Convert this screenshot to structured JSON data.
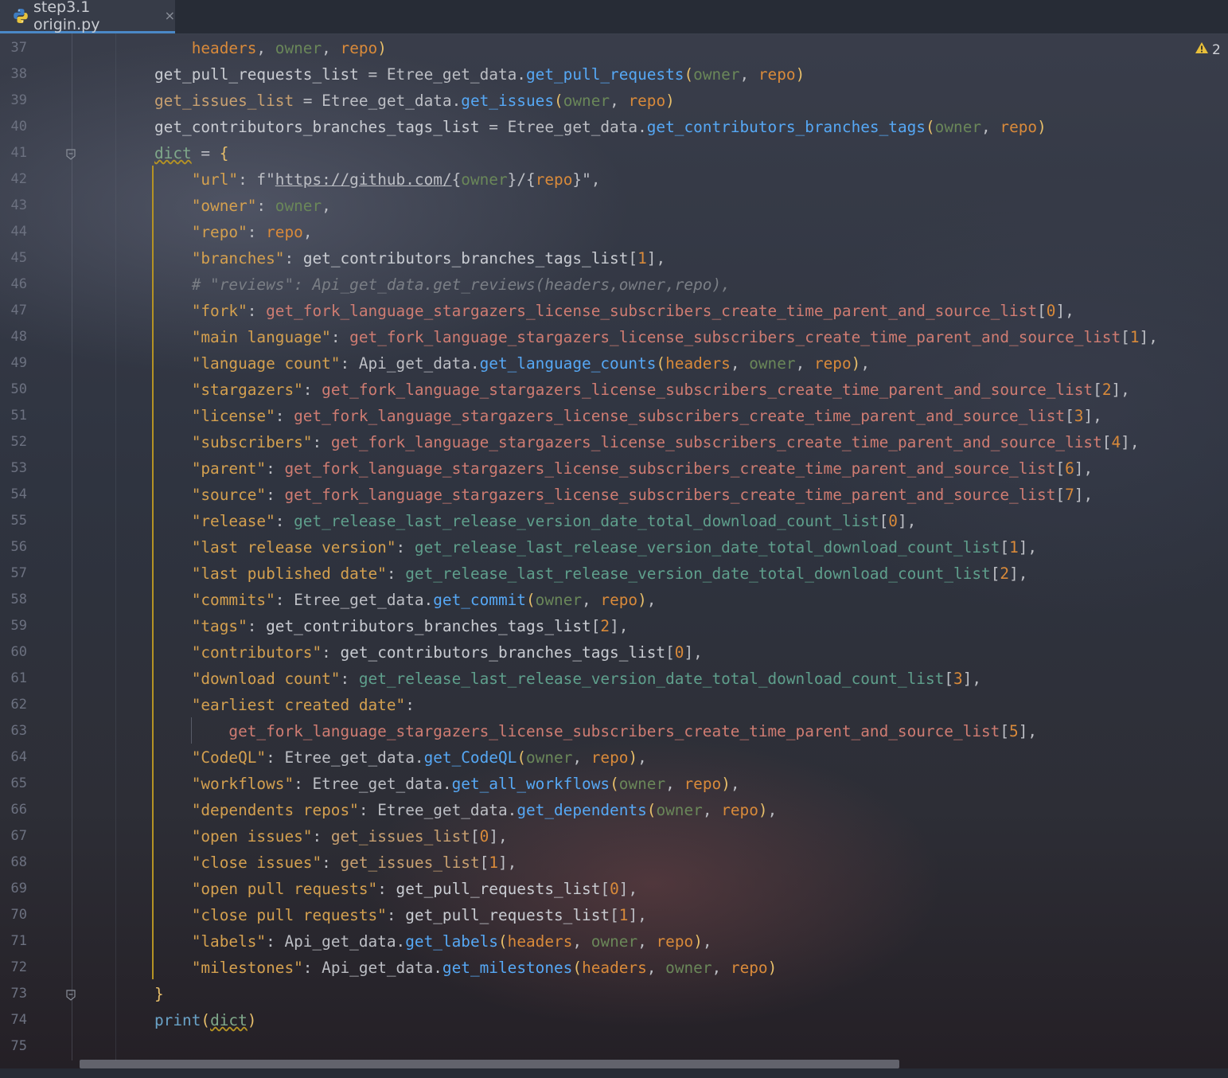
{
  "tab": {
    "title": "step3.1 origin.py",
    "close": "×",
    "icon": "python-file-icon"
  },
  "warnings": {
    "count": "2",
    "icon": "warning-triangle-icon",
    "color": "#e8bf3a"
  },
  "colors": {
    "accent": "#4a88c7",
    "string": "#d4a04f",
    "function": "#56a8f5",
    "param_orange": "#d98a3a",
    "param_green": "#6a8759",
    "bracket": "#e8bf6a",
    "comment": "#7a7e85",
    "guide": "#b59324"
  },
  "lines": [
    {
      "n": "37",
      "t": [
        [
          "    headers",
          "p1"
        ],
        [
          ", ",
          "id"
        ],
        [
          "owner",
          "p2"
        ],
        [
          ", ",
          "id"
        ],
        [
          "repo",
          "p1"
        ],
        [
          ")",
          "brk"
        ]
      ]
    },
    {
      "n": "38",
      "t": [
        [
          "get_pull_requests_list",
          "v"
        ],
        [
          " = Etree_get_data.",
          "id"
        ],
        [
          "get_pull_requests",
          "fn"
        ],
        [
          "(",
          "brk"
        ],
        [
          "owner",
          "p2"
        ],
        [
          ", ",
          "id"
        ],
        [
          "repo",
          "p1"
        ],
        [
          ")",
          "brk"
        ]
      ]
    },
    {
      "n": "39",
      "t": [
        [
          "get_issues_list",
          "v2"
        ],
        [
          " = Etree_get_data.",
          "id"
        ],
        [
          "get_issues",
          "fn"
        ],
        [
          "(",
          "brk"
        ],
        [
          "owner",
          "p2"
        ],
        [
          ", ",
          "id"
        ],
        [
          "repo",
          "p1"
        ],
        [
          ")",
          "brk"
        ]
      ]
    },
    {
      "n": "40",
      "t": [
        [
          "get_contributors_branches_tags_list",
          "v"
        ],
        [
          " = Etree_get_data.",
          "id"
        ],
        [
          "get_contributors_branches_tags",
          "fn"
        ],
        [
          "(",
          "brk"
        ],
        [
          "owner",
          "p2"
        ],
        [
          ", ",
          "id"
        ],
        [
          "repo",
          "p1"
        ],
        [
          ")",
          "brk"
        ]
      ]
    },
    {
      "n": "41",
      "t": [
        [
          "dict",
          "bi"
        ],
        [
          " = ",
          "id"
        ],
        [
          "{",
          "brk"
        ]
      ]
    },
    {
      "n": "42",
      "t": [
        [
          "    \"url\"",
          "s"
        ],
        [
          ": f\"",
          "id"
        ],
        [
          "https://github.com/",
          "url"
        ],
        [
          "{",
          "id"
        ],
        [
          "owner",
          "p2"
        ],
        [
          "}/{",
          "id"
        ],
        [
          "repo",
          "p1"
        ],
        [
          "}\"",
          "id"
        ],
        [
          ",",
          "id"
        ]
      ]
    },
    {
      "n": "43",
      "t": [
        [
          "    \"owner\"",
          "s"
        ],
        [
          ": ",
          "id"
        ],
        [
          "owner",
          "p2"
        ],
        [
          ",",
          "id"
        ]
      ]
    },
    {
      "n": "44",
      "t": [
        [
          "    \"repo\"",
          "s"
        ],
        [
          ": ",
          "id"
        ],
        [
          "repo",
          "p1"
        ],
        [
          ",",
          "id"
        ]
      ]
    },
    {
      "n": "45",
      "t": [
        [
          "    \"branches\"",
          "s"
        ],
        [
          ": ",
          "id"
        ],
        [
          "get_contributors_branches_tags_list",
          "v"
        ],
        [
          "[",
          "id"
        ],
        [
          "1",
          "num"
        ],
        [
          "],",
          "id"
        ]
      ]
    },
    {
      "n": "46",
      "t": [
        [
          "    # \"reviews\": Api_get_data.get_reviews(headers,owner,repo),",
          "cm"
        ]
      ]
    },
    {
      "n": "47",
      "t": [
        [
          "    \"fork\"",
          "s"
        ],
        [
          ": ",
          "id"
        ],
        [
          "get_fork_language_stargazers_license_subscribers_create_time_parent_and_source_list",
          "v3"
        ],
        [
          "[",
          "id"
        ],
        [
          "0",
          "num"
        ],
        [
          "],",
          "id"
        ]
      ]
    },
    {
      "n": "48",
      "t": [
        [
          "    \"main language\"",
          "s"
        ],
        [
          ": ",
          "id"
        ],
        [
          "get_fork_language_stargazers_license_subscribers_create_time_parent_and_source_list",
          "v3"
        ],
        [
          "[",
          "id"
        ],
        [
          "1",
          "num"
        ],
        [
          "],",
          "id"
        ]
      ]
    },
    {
      "n": "49",
      "t": [
        [
          "    \"language count\"",
          "s"
        ],
        [
          ": Api_get_data.",
          "id"
        ],
        [
          "get_language_counts",
          "fn"
        ],
        [
          "(",
          "brk"
        ],
        [
          "headers",
          "p1"
        ],
        [
          ", ",
          "id"
        ],
        [
          "owner",
          "p2"
        ],
        [
          ", ",
          "id"
        ],
        [
          "repo",
          "p1"
        ],
        [
          ")",
          "brk"
        ],
        [
          ",",
          "id"
        ]
      ]
    },
    {
      "n": "50",
      "t": [
        [
          "    \"stargazers\"",
          "s"
        ],
        [
          ": ",
          "id"
        ],
        [
          "get_fork_language_stargazers_license_subscribers_create_time_parent_and_source_list",
          "v3"
        ],
        [
          "[",
          "id"
        ],
        [
          "2",
          "num"
        ],
        [
          "],",
          "id"
        ]
      ]
    },
    {
      "n": "51",
      "t": [
        [
          "    \"license\"",
          "s"
        ],
        [
          ": ",
          "id"
        ],
        [
          "get_fork_language_stargazers_license_subscribers_create_time_parent_and_source_list",
          "v3"
        ],
        [
          "[",
          "id"
        ],
        [
          "3",
          "num"
        ],
        [
          "],",
          "id"
        ]
      ]
    },
    {
      "n": "52",
      "t": [
        [
          "    \"subscribers\"",
          "s"
        ],
        [
          ": ",
          "id"
        ],
        [
          "get_fork_language_stargazers_license_subscribers_create_time_parent_and_source_list",
          "v3"
        ],
        [
          "[",
          "id"
        ],
        [
          "4",
          "num"
        ],
        [
          "],",
          "id"
        ]
      ]
    },
    {
      "n": "53",
      "t": [
        [
          "    \"parent\"",
          "s"
        ],
        [
          ": ",
          "id"
        ],
        [
          "get_fork_language_stargazers_license_subscribers_create_time_parent_and_source_list",
          "v3"
        ],
        [
          "[",
          "id"
        ],
        [
          "6",
          "num"
        ],
        [
          "],",
          "id"
        ]
      ]
    },
    {
      "n": "54",
      "t": [
        [
          "    \"source\"",
          "s"
        ],
        [
          ": ",
          "id"
        ],
        [
          "get_fork_language_stargazers_license_subscribers_create_time_parent_and_source_list",
          "v3"
        ],
        [
          "[",
          "id"
        ],
        [
          "7",
          "num"
        ],
        [
          "],",
          "id"
        ]
      ]
    },
    {
      "n": "55",
      "t": [
        [
          "    \"release\"",
          "s"
        ],
        [
          ": ",
          "id"
        ],
        [
          "get_release_last_release_version_date_total_download_count_list",
          "v4"
        ],
        [
          "[",
          "id"
        ],
        [
          "0",
          "num"
        ],
        [
          "],",
          "id"
        ]
      ]
    },
    {
      "n": "56",
      "t": [
        [
          "    \"last release version\"",
          "s"
        ],
        [
          ": ",
          "id"
        ],
        [
          "get_release_last_release_version_date_total_download_count_list",
          "v4"
        ],
        [
          "[",
          "id"
        ],
        [
          "1",
          "num"
        ],
        [
          "],",
          "id"
        ]
      ]
    },
    {
      "n": "57",
      "t": [
        [
          "    \"last published date\"",
          "s"
        ],
        [
          ": ",
          "id"
        ],
        [
          "get_release_last_release_version_date_total_download_count_list",
          "v4"
        ],
        [
          "[",
          "id"
        ],
        [
          "2",
          "num"
        ],
        [
          "],",
          "id"
        ]
      ]
    },
    {
      "n": "58",
      "t": [
        [
          "    \"commits\"",
          "s"
        ],
        [
          ": Etree_get_data.",
          "id"
        ],
        [
          "get_commit",
          "fn"
        ],
        [
          "(",
          "brk"
        ],
        [
          "owner",
          "p2"
        ],
        [
          ", ",
          "id"
        ],
        [
          "repo",
          "p1"
        ],
        [
          ")",
          "brk"
        ],
        [
          ",",
          "id"
        ]
      ]
    },
    {
      "n": "59",
      "t": [
        [
          "    \"tags\"",
          "s"
        ],
        [
          ": ",
          "id"
        ],
        [
          "get_contributors_branches_tags_list",
          "v"
        ],
        [
          "[",
          "id"
        ],
        [
          "2",
          "num"
        ],
        [
          "],",
          "id"
        ]
      ]
    },
    {
      "n": "60",
      "t": [
        [
          "    \"contributors\"",
          "s"
        ],
        [
          ": ",
          "id"
        ],
        [
          "get_contributors_branches_tags_list",
          "v"
        ],
        [
          "[",
          "id"
        ],
        [
          "0",
          "num"
        ],
        [
          "],",
          "id"
        ]
      ]
    },
    {
      "n": "61",
      "t": [
        [
          "    \"download count\"",
          "s"
        ],
        [
          ": ",
          "id"
        ],
        [
          "get_release_last_release_version_date_total_download_count_list",
          "v4"
        ],
        [
          "[",
          "id"
        ],
        [
          "3",
          "num"
        ],
        [
          "],",
          "id"
        ]
      ]
    },
    {
      "n": "62",
      "t": [
        [
          "    \"earliest created date\"",
          "s"
        ],
        [
          ":",
          "id"
        ]
      ]
    },
    {
      "n": "63",
      "t": [
        [
          "        get_fork_language_stargazers_license_subscribers_create_time_parent_and_source_list",
          "v3"
        ],
        [
          "[",
          "id"
        ],
        [
          "5",
          "num"
        ],
        [
          "],",
          "id"
        ]
      ]
    },
    {
      "n": "64",
      "t": [
        [
          "    \"CodeQL\"",
          "s"
        ],
        [
          ": Etree_get_data.",
          "id"
        ],
        [
          "get_CodeQL",
          "fn"
        ],
        [
          "(",
          "brk"
        ],
        [
          "owner",
          "p2"
        ],
        [
          ", ",
          "id"
        ],
        [
          "repo",
          "p1"
        ],
        [
          ")",
          "brk"
        ],
        [
          ",",
          "id"
        ]
      ]
    },
    {
      "n": "65",
      "t": [
        [
          "    \"workflows\"",
          "s"
        ],
        [
          ": Etree_get_data.",
          "id"
        ],
        [
          "get_all_workflows",
          "fn"
        ],
        [
          "(",
          "brk"
        ],
        [
          "owner",
          "p2"
        ],
        [
          ", ",
          "id"
        ],
        [
          "repo",
          "p1"
        ],
        [
          ")",
          "brk"
        ],
        [
          ",",
          "id"
        ]
      ]
    },
    {
      "n": "66",
      "t": [
        [
          "    \"dependents repos\"",
          "s"
        ],
        [
          ": Etree_get_data.",
          "id"
        ],
        [
          "get_dependents",
          "fn"
        ],
        [
          "(",
          "brk"
        ],
        [
          "owner",
          "p2"
        ],
        [
          ", ",
          "id"
        ],
        [
          "repo",
          "p1"
        ],
        [
          ")",
          "brk"
        ],
        [
          ",",
          "id"
        ]
      ]
    },
    {
      "n": "67",
      "t": [
        [
          "    \"open issues\"",
          "s"
        ],
        [
          ": ",
          "id"
        ],
        [
          "get_issues_list",
          "v2"
        ],
        [
          "[",
          "id"
        ],
        [
          "0",
          "num"
        ],
        [
          "],",
          "id"
        ]
      ]
    },
    {
      "n": "68",
      "t": [
        [
          "    \"close issues\"",
          "s"
        ],
        [
          ": ",
          "id"
        ],
        [
          "get_issues_list",
          "v2"
        ],
        [
          "[",
          "id"
        ],
        [
          "1",
          "num"
        ],
        [
          "],",
          "id"
        ]
      ]
    },
    {
      "n": "69",
      "t": [
        [
          "    \"open pull requests\"",
          "s"
        ],
        [
          ": ",
          "id"
        ],
        [
          "get_pull_requests_list",
          "v"
        ],
        [
          "[",
          "id"
        ],
        [
          "0",
          "num"
        ],
        [
          "],",
          "id"
        ]
      ]
    },
    {
      "n": "70",
      "t": [
        [
          "    \"close pull requests\"",
          "s"
        ],
        [
          ": ",
          "id"
        ],
        [
          "get_pull_requests_list",
          "v"
        ],
        [
          "[",
          "id"
        ],
        [
          "1",
          "num"
        ],
        [
          "],",
          "id"
        ]
      ]
    },
    {
      "n": "71",
      "t": [
        [
          "    \"labels\"",
          "s"
        ],
        [
          ": Api_get_data.",
          "id"
        ],
        [
          "get_labels",
          "fn"
        ],
        [
          "(",
          "brk"
        ],
        [
          "headers",
          "p1"
        ],
        [
          ", ",
          "id"
        ],
        [
          "owner",
          "p2"
        ],
        [
          ", ",
          "id"
        ],
        [
          "repo",
          "p1"
        ],
        [
          ")",
          "brk"
        ],
        [
          ",",
          "id"
        ]
      ]
    },
    {
      "n": "72",
      "t": [
        [
          "    \"milestones\"",
          "s"
        ],
        [
          ": Api_get_data.",
          "id"
        ],
        [
          "get_milestones",
          "fn"
        ],
        [
          "(",
          "brk"
        ],
        [
          "headers",
          "p1"
        ],
        [
          ", ",
          "id"
        ],
        [
          "owner",
          "p2"
        ],
        [
          ", ",
          "id"
        ],
        [
          "repo",
          "p1"
        ],
        [
          ")",
          "brk"
        ]
      ]
    },
    {
      "n": "73",
      "t": [
        [
          "}",
          "brk"
        ]
      ]
    },
    {
      "n": "74",
      "t": [
        [
          "print",
          "bi2"
        ],
        [
          "(",
          "brk"
        ],
        [
          "dict",
          "bi"
        ],
        [
          ")",
          "brk"
        ]
      ]
    },
    {
      "n": "75",
      "t": []
    }
  ]
}
